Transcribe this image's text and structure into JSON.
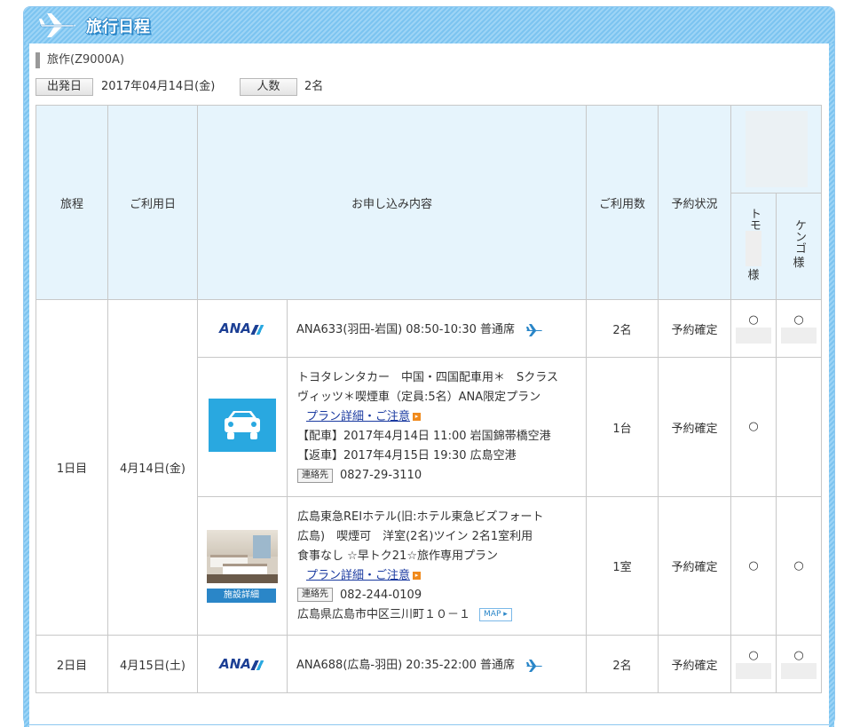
{
  "header": {
    "title": "旅行日程",
    "icon": "airplane-icon",
    "accent_color": "#7cc4f0"
  },
  "tour": {
    "name": "旅作(Z9000A)",
    "departure_label": "出発日",
    "departure_date": "2017年04月14日(金)",
    "people_label": "人数",
    "people_count": "2名"
  },
  "table": {
    "headers": {
      "itinerary": "旅程",
      "date": "ご利用日",
      "content": "お申し込み内容",
      "count": "ご利用数",
      "status": "予約状況",
      "traveler1": "トモ",
      "traveler2": "ケンゴ",
      "traveler_suffix": "様"
    },
    "day1": {
      "label": "1日目",
      "date": "4月14日(金)",
      "flight": {
        "logo": "ANA",
        "text": "ANA633(羽田-岩国) 08:50-10:30 普通席",
        "count": "2名",
        "status": "予約確定",
        "mark1": "○",
        "mark2": "○"
      },
      "car": {
        "icon": "car-icon",
        "line1": "トヨタレンタカー　中国・四国配車用＊　Sクラス",
        "line2": "ヴィッツ＊喫煙車（定員:5名）ANA限定プラン",
        "plan_link": "プラン詳細・ご注意",
        "pickup": "【配車】2017年4月14日 11:00 岩国錦帯橋空港",
        "return": "【返車】2017年4月15日 19:30 広島空港",
        "contact_label": "連絡先",
        "contact": "0827-29-3110",
        "count": "1台",
        "status": "予約確定",
        "mark1": "○"
      },
      "hotel": {
        "facility_label": "施設詳細",
        "line1": "広島東急REIホテル(旧:ホテル東急ビズフォート",
        "line2": "広島)　喫煙可　洋室(2名)ツイン 2名1室利用",
        "line3": "食事なし ☆早トク21☆旅作専用プラン",
        "plan_link": "プラン詳細・ご注意",
        "contact_label": "連絡先",
        "contact": "082-244-0109",
        "address": "広島県広島市中区三川町１０－１",
        "map_label": "MAP ▸",
        "count": "1室",
        "status": "予約確定",
        "mark1": "○",
        "mark2": "○"
      }
    },
    "day2": {
      "label": "2日目",
      "date": "4月15日(土)",
      "flight": {
        "logo": "ANA",
        "text": "ANA688(広島-羽田) 20:35-22:00 普通席",
        "count": "2名",
        "status": "予約確定",
        "mark1": "○",
        "mark2": "○"
      }
    }
  }
}
